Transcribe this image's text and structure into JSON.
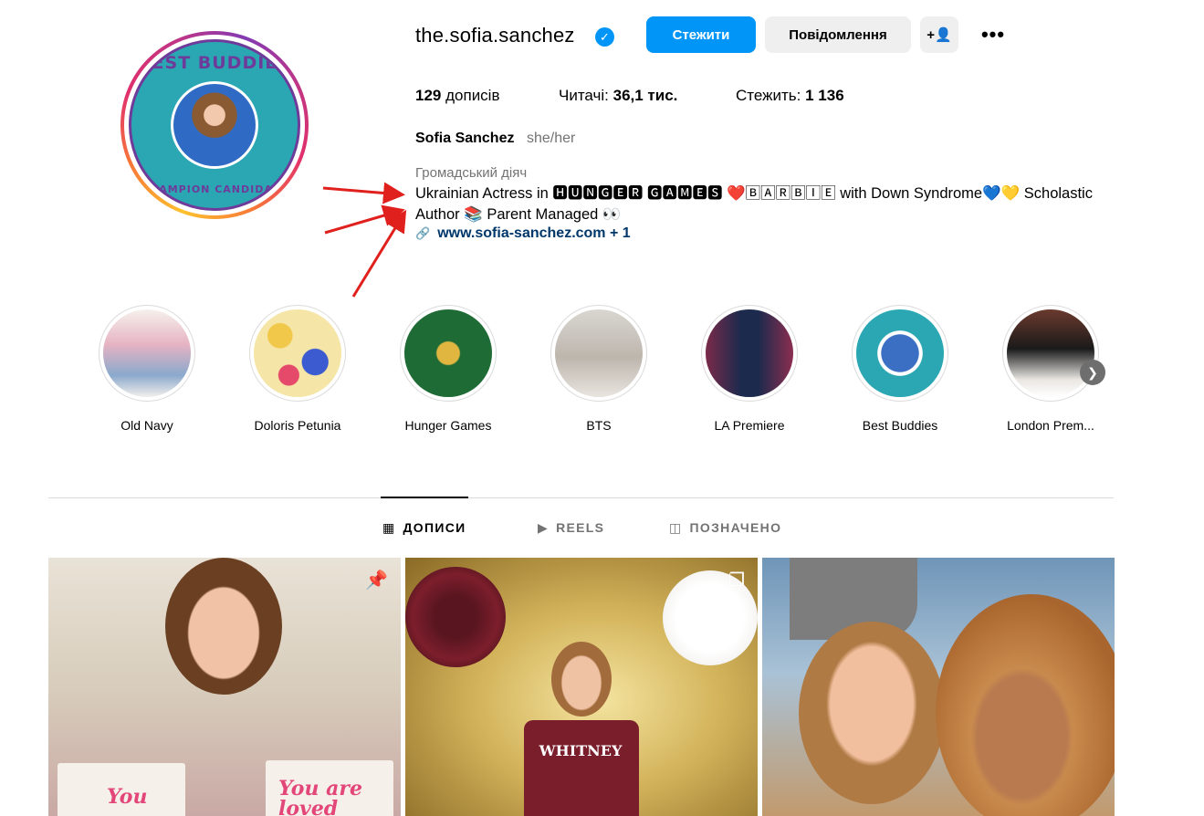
{
  "profile": {
    "username": "the.sofia.sanchez",
    "verified_icon": "verified-badge-icon",
    "full_name": "Sofia Sanchez",
    "pronouns": "she/her",
    "category": "Громадський діяч",
    "bio_line1": "Ukrainian Actress in 🅷🆄🅽🅶🅴🆁 🅶🅰🅼🅴🆂 ❤️🄱🄰🅁🄱🄸🄴 with Down Syndrome💙💛 Scholastic",
    "bio_line2": "Author 📚 Parent Managed 👀",
    "link_text": "www.sofia-sanchez.com + 1",
    "avatar_text_top": "BEST BUDDIES",
    "avatar_text_bottom": "CHAMPION CANDIDATE"
  },
  "actions": {
    "follow_label": "Стежити",
    "message_label": "Повідомлення",
    "add_user_label": "+👤",
    "more_label": "•••"
  },
  "stats": {
    "posts_count": "129",
    "posts_label": "дописів",
    "followers_label": "Читачі:",
    "followers_count": "36,1 тис.",
    "following_label": "Стежить:",
    "following_count": "1 136"
  },
  "highlights": [
    {
      "label": "Old Navy"
    },
    {
      "label": "Doloris Petunia"
    },
    {
      "label": "Hunger Games"
    },
    {
      "label": "BTS"
    },
    {
      "label": "LA Premiere"
    },
    {
      "label": "Best Buddies"
    },
    {
      "label": "London Prem..."
    }
  ],
  "tabs": [
    {
      "label": "ДОПИСИ",
      "icon": "grid-icon",
      "active": true
    },
    {
      "label": "REELS",
      "icon": "reels-icon",
      "active": false
    },
    {
      "label": "ПОЗНАЧЕНО",
      "icon": "tagged-icon",
      "active": false
    }
  ],
  "posts": [
    {
      "badge_icon": "pin-icon",
      "book1": "You are",
      "book2": "You are loved"
    },
    {
      "badge_icon": "carousel-icon",
      "shirt_text": "WHITNEY"
    },
    {
      "badge_icon": ""
    }
  ],
  "colors": {
    "accent": "#0095f6",
    "link": "#00376b",
    "muted": "#737373",
    "annotation_arrow": "#e0201c"
  }
}
